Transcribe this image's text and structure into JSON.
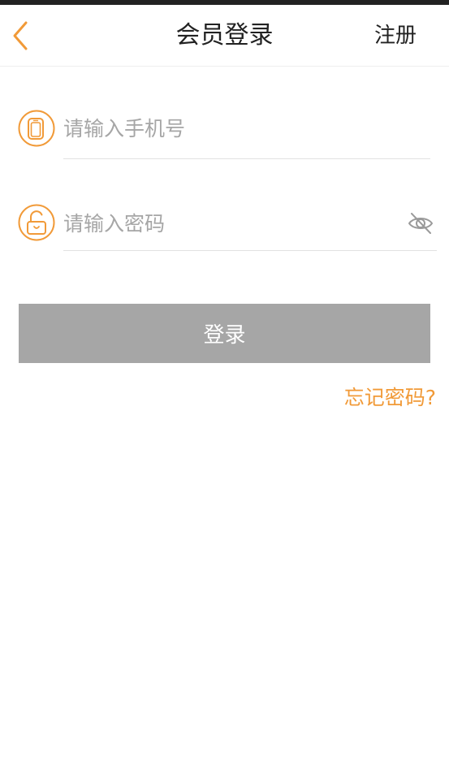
{
  "header": {
    "title": "会员登录",
    "register_label": "注册"
  },
  "form": {
    "phone_placeholder": "请输入手机号",
    "phone_value": "",
    "password_placeholder": "请输入密码",
    "password_value": "",
    "login_label": "登录",
    "forgot_label": "忘记密码?"
  },
  "icons": {
    "back": "chevron-left-icon",
    "phone": "phone-icon",
    "lock": "unlock-icon",
    "eye": "eye-off-icon"
  },
  "colors": {
    "accent": "#f19a38",
    "button_disabled": "#a6a6a6",
    "text_dark": "#222222",
    "placeholder": "#a6a6a6"
  }
}
